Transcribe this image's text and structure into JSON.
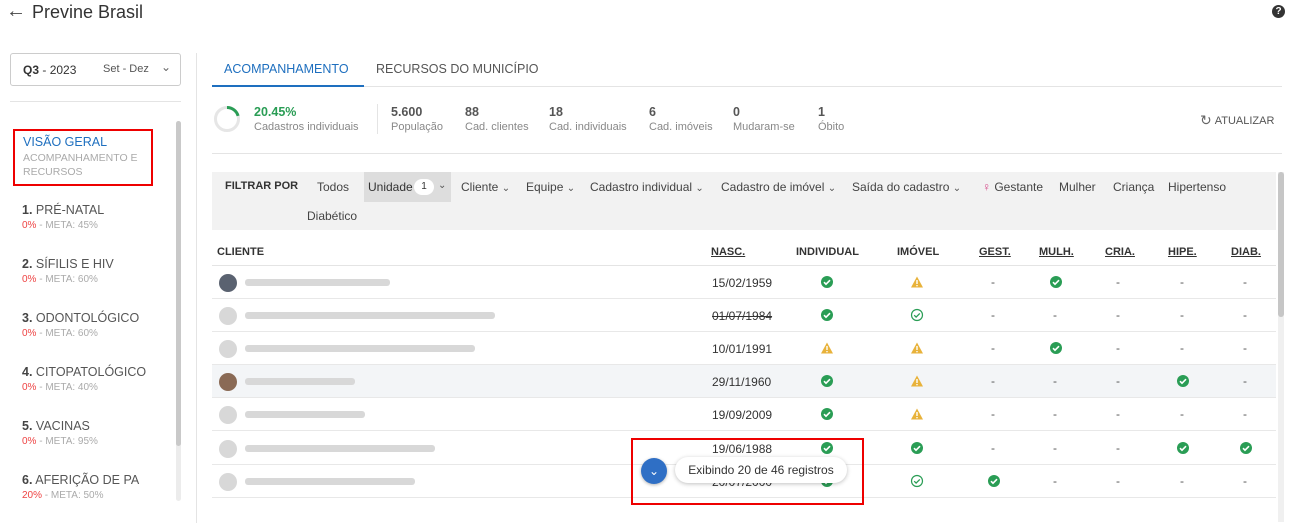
{
  "header": {
    "title": "Previne Brasil",
    "back_icon": "arrow-left-icon",
    "help_icon": "question-circle-icon"
  },
  "quarter": {
    "q": "Q3",
    "sep": " - ",
    "year": "2023",
    "range": "Set - Dez"
  },
  "sidebar": {
    "overview": {
      "title": "VISÃO GERAL",
      "subtitle": "ACOMPANHAMENTO E RECURSOS"
    },
    "items": [
      {
        "num": "1.",
        "label": "PRÉ-NATAL",
        "pct": "0%",
        "meta": " - META: 45%"
      },
      {
        "num": "2.",
        "label": "SÍFILIS E HIV",
        "pct": "0%",
        "meta": " - META: 60%"
      },
      {
        "num": "3.",
        "label": "ODONTOLÓGICO",
        "pct": "0%",
        "meta": " - META: 60%"
      },
      {
        "num": "4.",
        "label": "CITOPATOLÓGICO",
        "pct": "0%",
        "meta": " - META: 40%"
      },
      {
        "num": "5.",
        "label": "VACINAS",
        "pct": "0%",
        "meta": " - META: 95%"
      },
      {
        "num": "6.",
        "label": "AFERIÇÃO DE PA",
        "pct": "20%",
        "meta": " - META: 50%"
      }
    ]
  },
  "tabs": {
    "active": "ACOMPANHAMENTO",
    "other": "RECURSOS DO MUNICÍPIO"
  },
  "stats": {
    "main": {
      "value": "20.45%",
      "label": "Cadastros individuais",
      "fraction": 0.2045
    },
    "items": [
      {
        "value": "5.600",
        "label": "População"
      },
      {
        "value": "88",
        "label": "Cad. clientes"
      },
      {
        "value": "18",
        "label": "Cad. individuais"
      },
      {
        "value": "6",
        "label": "Cad. imóveis"
      },
      {
        "value": "0",
        "label": "Mudaram-se"
      },
      {
        "value": "1",
        "label": "Óbito"
      }
    ],
    "refresh": "ATUALIZAR"
  },
  "filters": {
    "label": "FILTRAR POR",
    "todos": "Todos",
    "unidade": "Unidade",
    "unidade_count": "1",
    "cliente": "Cliente",
    "equipe": "Equipe",
    "cad_individual": "Cadastro individual",
    "cad_imovel": "Cadastro de imóvel",
    "saida": "Saída do cadastro",
    "gestante": "Gestante",
    "mulher": "Mulher",
    "crianca": "Criança",
    "hipertenso": "Hipertenso",
    "diabetico": "Diabético"
  },
  "table": {
    "headers": {
      "cliente": "CLIENTE",
      "nasc": "NASC.",
      "individual": "INDIVIDUAL",
      "imovel": "IMÓVEL",
      "gest": "GEST.",
      "mulh": "MULH.",
      "cria": "CRIA.",
      "hipe": "HIPE.",
      "diab": "DIAB."
    },
    "rows": [
      {
        "nasc": "15/02/1959",
        "individual": "check",
        "imovel": "warn",
        "gest": "-",
        "mulh": "check",
        "cria": "-",
        "hipe": "-",
        "diab": "-"
      },
      {
        "nasc": "01/07/1984",
        "individual": "check",
        "imovel": "check-outline",
        "gest": "-",
        "mulh": "-",
        "cria": "-",
        "hipe": "-",
        "diab": "-"
      },
      {
        "nasc": "10/01/1991",
        "individual": "warn",
        "imovel": "warn",
        "gest": "-",
        "mulh": "check",
        "cria": "-",
        "hipe": "-",
        "diab": "-"
      },
      {
        "nasc": "29/11/1960",
        "individual": "check",
        "imovel": "warn",
        "gest": "-",
        "mulh": "-",
        "cria": "-",
        "hipe": "check",
        "diab": "-"
      },
      {
        "nasc": "19/09/2009",
        "individual": "check",
        "imovel": "warn",
        "gest": "-",
        "mulh": "-",
        "cria": "-",
        "hipe": "-",
        "diab": "-"
      },
      {
        "nasc": "19/06/1988",
        "individual": "check",
        "imovel": "check",
        "gest": "-",
        "mulh": "-",
        "cria": "-",
        "hipe": "check",
        "diab": "check"
      },
      {
        "nasc": "20/07/2000",
        "individual": "check",
        "imovel": "check-outline",
        "gest": "check",
        "mulh": "-",
        "cria": "-",
        "hipe": "-",
        "diab": "-"
      }
    ]
  },
  "overlay": {
    "text": "Exibindo 20 de 46 registros",
    "fab_icon": "chevron-down-icon"
  },
  "colors": {
    "accent": "#1e6fbf",
    "success": "#2a9d55",
    "warning": "#e8b23a",
    "danger": "#e44444",
    "highlight": "#e00000"
  }
}
